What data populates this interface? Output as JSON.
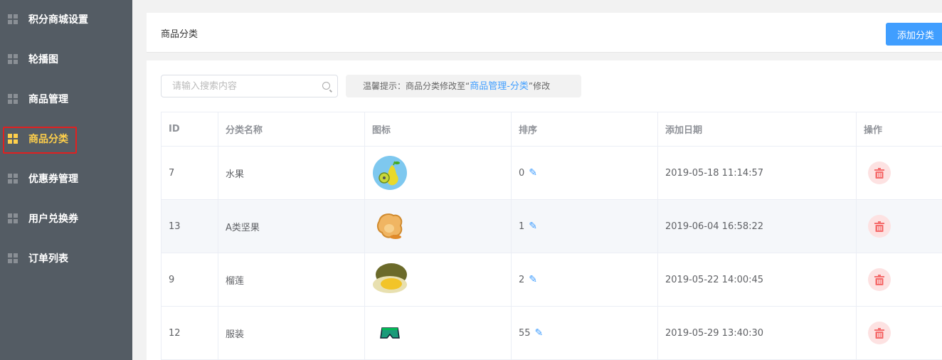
{
  "sidebar": {
    "items": [
      {
        "label": "积分商城设置",
        "active": false
      },
      {
        "label": "轮播图",
        "active": false
      },
      {
        "label": "商品管理",
        "active": false
      },
      {
        "label": "商品分类",
        "active": true
      },
      {
        "label": "优惠券管理",
        "active": false
      },
      {
        "label": "用户兑换券",
        "active": false
      },
      {
        "label": "订单列表",
        "active": false
      }
    ]
  },
  "header": {
    "title": "商品分类",
    "add_button": "添加分类"
  },
  "search": {
    "placeholder": "请输入搜索内容"
  },
  "tip": {
    "prefix": "温馨提示：商品分类修改至“",
    "link": "商品管理-分类",
    "suffix": "”修改"
  },
  "table": {
    "columns": [
      "ID",
      "分类名称",
      "图标",
      "排序",
      "添加日期",
      "操作"
    ],
    "rows": [
      {
        "id": "7",
        "name": "水果",
        "icon": "pear-image",
        "sort": "0",
        "date": "2019-05-18 11:14:57"
      },
      {
        "id": "13",
        "name": "A类坚果",
        "icon": "nut-image",
        "sort": "1",
        "date": "2019-06-04 16:58:22"
      },
      {
        "id": "9",
        "name": "榴莲",
        "icon": "durian-image",
        "sort": "2",
        "date": "2019-05-22 14:00:45"
      },
      {
        "id": "12",
        "name": "服装",
        "icon": "shorts-image",
        "sort": "55",
        "date": "2019-05-29 13:40:30"
      }
    ]
  },
  "colors": {
    "sidebar": "#545c64",
    "active": "#ffd04b",
    "primary": "#409eff",
    "danger": "#f56c6c"
  }
}
